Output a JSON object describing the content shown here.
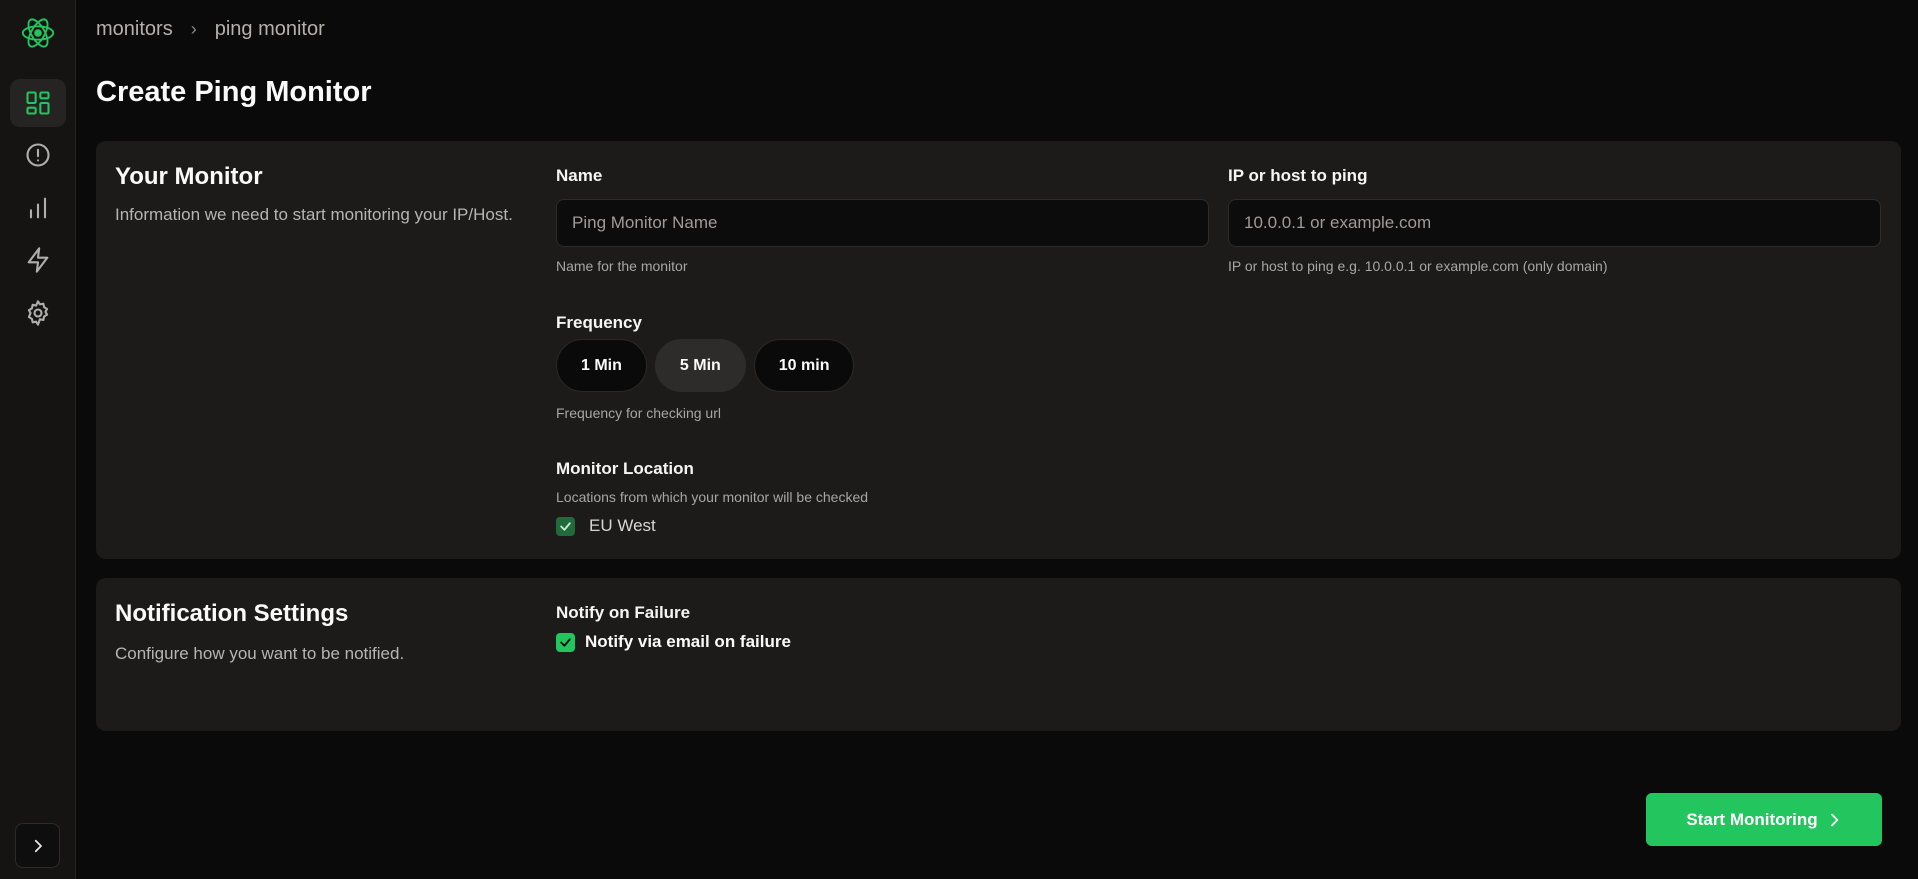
{
  "sidebar": {
    "logo_icon": "atom-logo-icon",
    "items": [
      {
        "icon": "dashboard-icon",
        "active": true
      },
      {
        "icon": "alert-circle-icon",
        "active": false
      },
      {
        "icon": "bar-chart-icon",
        "active": false
      },
      {
        "icon": "lightning-icon",
        "active": false
      },
      {
        "icon": "gear-icon",
        "active": false
      }
    ],
    "expand_icon": "chevron-right-icon"
  },
  "breadcrumb": {
    "items": [
      "monitors",
      "ping monitor"
    ],
    "separator": "›"
  },
  "page_title": "Create Ping Monitor",
  "monitor_card": {
    "title": "Your Monitor",
    "description": "Information we need to start monitoring your IP/Host.",
    "name": {
      "label": "Name",
      "placeholder": "Ping Monitor Name",
      "hint": "Name for the monitor"
    },
    "host": {
      "label": "IP or host to ping",
      "placeholder": "10.0.0.1 or example.com",
      "hint": "IP or host to ping e.g. 10.0.0.1 or example.com (only domain)"
    },
    "frequency": {
      "label": "Frequency",
      "options": [
        "1 Min",
        "5 Min",
        "10 min"
      ],
      "selected": "5 Min",
      "hint": "Frequency for checking url"
    },
    "location": {
      "label": "Monitor Location",
      "hint": "Locations from which your monitor will be checked",
      "options": [
        {
          "label": "EU West",
          "checked": true
        }
      ]
    }
  },
  "notification_card": {
    "title": "Notification Settings",
    "description": "Configure how you want to be notified.",
    "notify_label": "Notify on Failure",
    "email_option": {
      "label": "Notify via email on failure",
      "checked": true
    }
  },
  "start_button": {
    "label": "Start Monitoring"
  },
  "colors": {
    "accent": "#22c55e",
    "background": "#0b0a0a",
    "card": "#1d1b1a"
  }
}
